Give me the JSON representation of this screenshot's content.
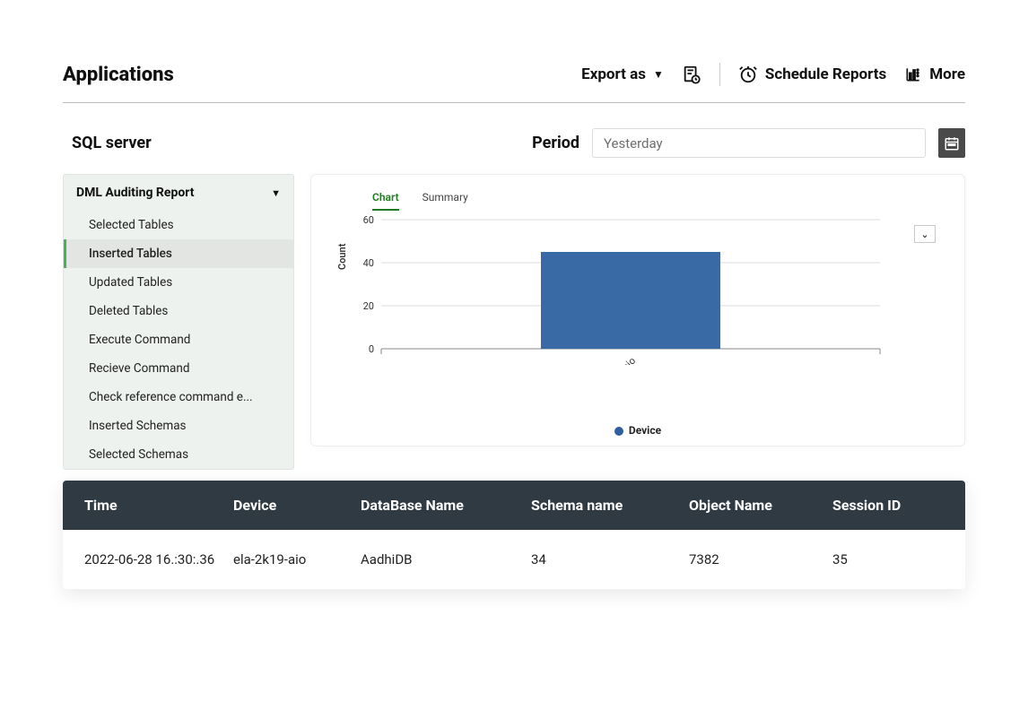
{
  "header": {
    "title": "Applications",
    "export_label": "Export as",
    "schedule_label": "Schedule Reports",
    "more_label": "More"
  },
  "subheader": {
    "title": "SQL server",
    "period_label": "Period",
    "period_value": "Yesterday"
  },
  "sidebar": {
    "group_title": "DML Auditing Report",
    "items": [
      {
        "label": "Selected Tables"
      },
      {
        "label": "Inserted Tables"
      },
      {
        "label": "Updated Tables"
      },
      {
        "label": "Deleted Tables"
      },
      {
        "label": "Execute Command"
      },
      {
        "label": "Recieve Command"
      },
      {
        "label": "Check reference command e..."
      },
      {
        "label": "Inserted Schemas"
      },
      {
        "label": "Selected Schemas"
      }
    ],
    "active_index": 1
  },
  "chart": {
    "tabs": [
      "Chart",
      "Summary"
    ],
    "active_tab": 0,
    "legend": "Device"
  },
  "chart_data": {
    "type": "bar",
    "categories": [
      "ela-2k19-aio"
    ],
    "values": [
      45
    ],
    "ylabel": "Count",
    "ylim": [
      0,
      60
    ],
    "yticks": [
      0,
      20,
      40,
      60
    ],
    "series_name": "Device",
    "bar_color": "#3a6aa6"
  },
  "table": {
    "columns": [
      "Time",
      "Device",
      "DataBase Name",
      "Schema name",
      "Object Name",
      "Session ID"
    ],
    "rows": [
      {
        "time": "2022-06-28 16.:30:.36",
        "device": "ela-2k19-aio",
        "db": "AadhiDB",
        "schema": "34",
        "object": "7382",
        "session": "35"
      }
    ]
  }
}
